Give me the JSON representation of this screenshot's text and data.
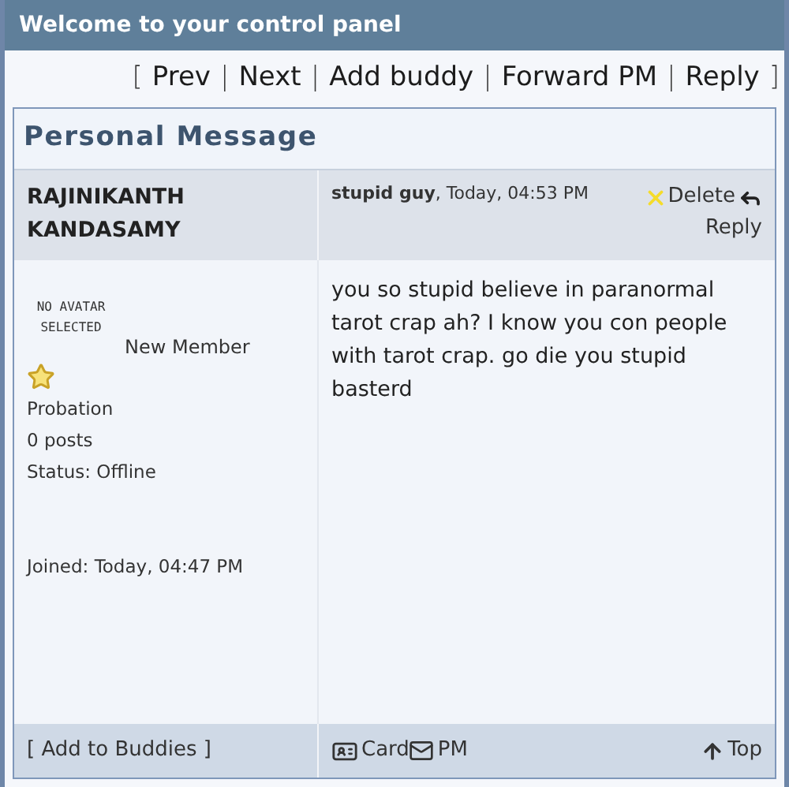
{
  "header": {
    "title": "Welcome to your control panel"
  },
  "nav": [
    {
      "kind": "punct",
      "text": "["
    },
    {
      "kind": "link",
      "text": "Prev"
    },
    {
      "kind": "punct",
      "text": "|"
    },
    {
      "kind": "link",
      "text": "Next"
    },
    {
      "kind": "punct",
      "text": "|"
    },
    {
      "kind": "link",
      "text": "Add buddy"
    },
    {
      "kind": "punct",
      "text": "|"
    },
    {
      "kind": "link",
      "text": "Forward PM"
    },
    {
      "kind": "punct",
      "text": "|"
    },
    {
      "kind": "link",
      "text": "Reply"
    },
    {
      "kind": "punct",
      "text": "]"
    }
  ],
  "panel": {
    "title": "Personal Message"
  },
  "author": {
    "name": "RAJINIKANTH KANDASAMY",
    "avatar_text": "NO AVATAR SELECTED",
    "rank": "New Member",
    "group": "Probation",
    "posts": "0 posts",
    "status": "Status: Offline",
    "joined": "Joined: Today, 04:47 PM"
  },
  "message": {
    "sender": "stupid guy",
    "date": ", Today, 04:53 PM",
    "actions": [
      {
        "kind": "delete",
        "label": "Delete"
      },
      {
        "kind": "reply",
        "label": "Reply"
      }
    ],
    "body": "you so stupid believe in paranormal tarot crap ah? I know you con people with tarot crap. go die you stupid basterd"
  },
  "footer": {
    "add_buddy": "[ Add to Buddies ]",
    "links": [
      {
        "kind": "card",
        "label": "Card"
      },
      {
        "kind": "pm",
        "label": "PM"
      }
    ],
    "top": "Top"
  }
}
